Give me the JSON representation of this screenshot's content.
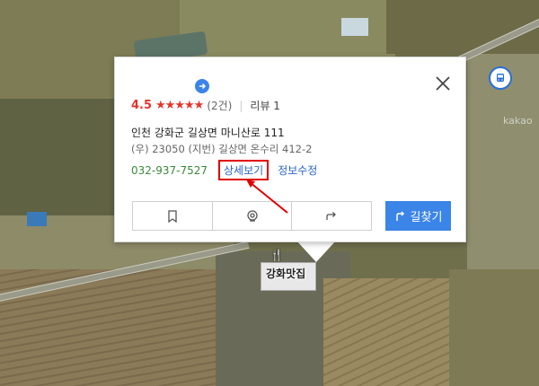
{
  "map": {
    "place_label": "강화맛집",
    "watermark": "kakao"
  },
  "card": {
    "rating_score": "4.5",
    "stars": "★★★★★",
    "rating_count": "(2건)",
    "review_label": "리뷰 1",
    "address": "인천 강화군 길상면 마니산로 111",
    "sub_address": "(우) 23050  (지번) 길상면 온수리 412-2",
    "phone": "032-937-7527",
    "detail_link": "상세보기",
    "edit_link": "정보수정",
    "route_label": "길찾기"
  },
  "colors": {
    "accent": "#3b84e8",
    "rating": "#e4352c",
    "highlight_box": "#e00000",
    "phone": "#3a8a3a",
    "link": "#2a65c9"
  },
  "icons": {
    "close": "close-icon",
    "share": "arrow-right-icon",
    "bookmark": "bookmark-icon",
    "roadview": "roadview-icon",
    "share_action": "share-icon",
    "route": "route-icon",
    "bus": "bus-icon"
  }
}
